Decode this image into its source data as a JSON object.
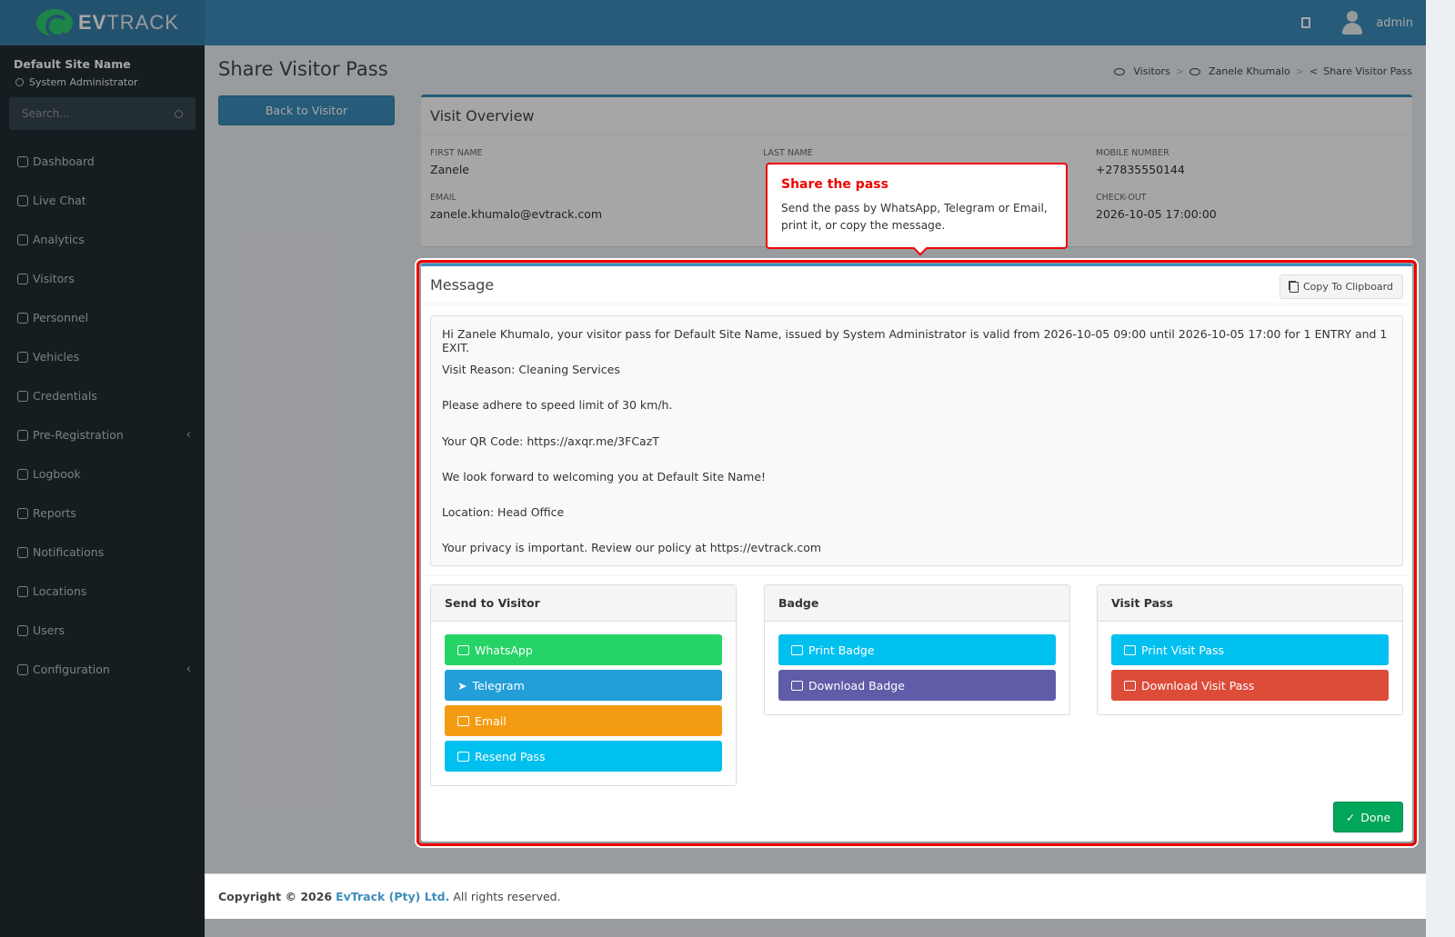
{
  "app": {
    "brand_a": "EV",
    "brand_b": "TRACK",
    "user": "admin"
  },
  "sidebar": {
    "site_name": "Default Site Name",
    "role": "System Administrator",
    "search_placeholder": "Search...",
    "items": [
      {
        "label": "Dashboard"
      },
      {
        "label": "Live Chat"
      },
      {
        "label": "Analytics"
      },
      {
        "label": "Visitors"
      },
      {
        "label": "Personnel"
      },
      {
        "label": "Vehicles"
      },
      {
        "label": "Credentials"
      },
      {
        "label": "Pre-Registration"
      },
      {
        "label": "Logbook"
      },
      {
        "label": "Reports"
      },
      {
        "label": "Notifications"
      },
      {
        "label": "Locations"
      },
      {
        "label": "Users"
      },
      {
        "label": "Configuration"
      }
    ]
  },
  "page": {
    "title": "Share Visitor Pass",
    "back_label": "Back to Visitor",
    "breadcrumb": [
      "Visitors",
      "Zanele Khumalo",
      "Share Visitor Pass"
    ]
  },
  "overview": {
    "title": "Visit Overview",
    "first_name_label": "FIRST NAME",
    "first_name": "Zanele",
    "last_name_label": "LAST NAME",
    "mobile_label": "MOBILE NUMBER",
    "mobile": "+27835550144",
    "email_label": "EMAIL",
    "email": "zanele.khumalo@evtrack.com",
    "checkout_label": "CHECK-OUT",
    "checkout": "2026-10-05 17:00:00"
  },
  "message": {
    "title": "Message",
    "copy_label": "Copy To Clipboard",
    "lines": [
      "Hi Zanele Khumalo, your visitor pass for Default Site Name, issued by System Administrator is valid from 2026-10-05 09:00 until 2026-10-05 17:00 for 1 ENTRY and 1 EXIT.",
      "Visit Reason: Cleaning Services",
      "Please adhere to speed limit of 30 km/h.",
      "Your QR Code: https://axqr.me/3FCazT",
      "We look forward to welcoming you at Default Site Name!",
      "Location:  Head Office",
      "Your privacy is important. Review our policy at https://evtrack.com"
    ]
  },
  "send": {
    "title": "Send to Visitor",
    "whatsapp": "WhatsApp",
    "telegram": "Telegram",
    "email": "Email",
    "resend": "Resend Pass"
  },
  "badge": {
    "title": "Badge",
    "print": "Print Badge",
    "download": "Download Badge"
  },
  "visitpass": {
    "title": "Visit Pass",
    "print": "Print Visit Pass",
    "download": "Download Visit Pass"
  },
  "done_label": "Done",
  "tooltip": {
    "title": "Share the pass",
    "body": "Send the pass by WhatsApp, Telegram or Email, print it, or copy the message."
  },
  "footer": {
    "copy": "Copyright © 2026",
    "company": "EvTrack (Pty) Ltd.",
    "rights": "All rights reserved."
  },
  "colors": {
    "primary": "#3c8dbc",
    "whatsapp": "#25d366",
    "telegram": "#229ed9",
    "email": "#f39c12",
    "info": "#00c0ef",
    "purple": "#605ca8",
    "danger": "#dd4b39",
    "success": "#00a65a",
    "highlight": "#e00000"
  }
}
